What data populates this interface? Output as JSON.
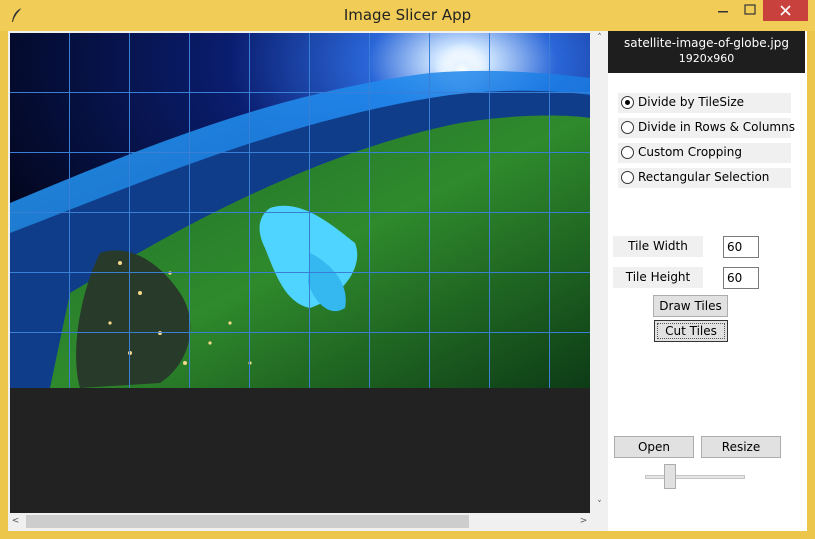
{
  "window": {
    "title": "Image Slicer App",
    "minimize": "—",
    "maximize": "□",
    "close": "✕"
  },
  "file": {
    "name": "satellite-image-of-globe.jpg",
    "dimensions": "1920x960"
  },
  "modes": [
    {
      "label": "Divide by TileSize",
      "selected": true
    },
    {
      "label": "Divide in Rows & Columns",
      "selected": false
    },
    {
      "label": "Custom Cropping",
      "selected": false
    },
    {
      "label": "Rectangular Selection",
      "selected": false
    }
  ],
  "tile": {
    "width_label": "Tile Width",
    "width_value": "60",
    "height_label": "Tile Height",
    "height_value": "60"
  },
  "buttons": {
    "draw_tiles": "Draw Tiles",
    "cut_tiles": "Cut Tiles",
    "open": "Open",
    "resize": "Resize"
  },
  "scroll": {
    "up_arrow": "˄",
    "down_arrow": "˅",
    "left_arrow": "<",
    "right_arrow": ">"
  },
  "resize_slider": {
    "level": 0.2
  },
  "colors": {
    "titlebar": "#f1cd58",
    "close_button": "#c9413d",
    "grid_line": "#3a7fd6",
    "header_bg": "#1e1e1e"
  }
}
